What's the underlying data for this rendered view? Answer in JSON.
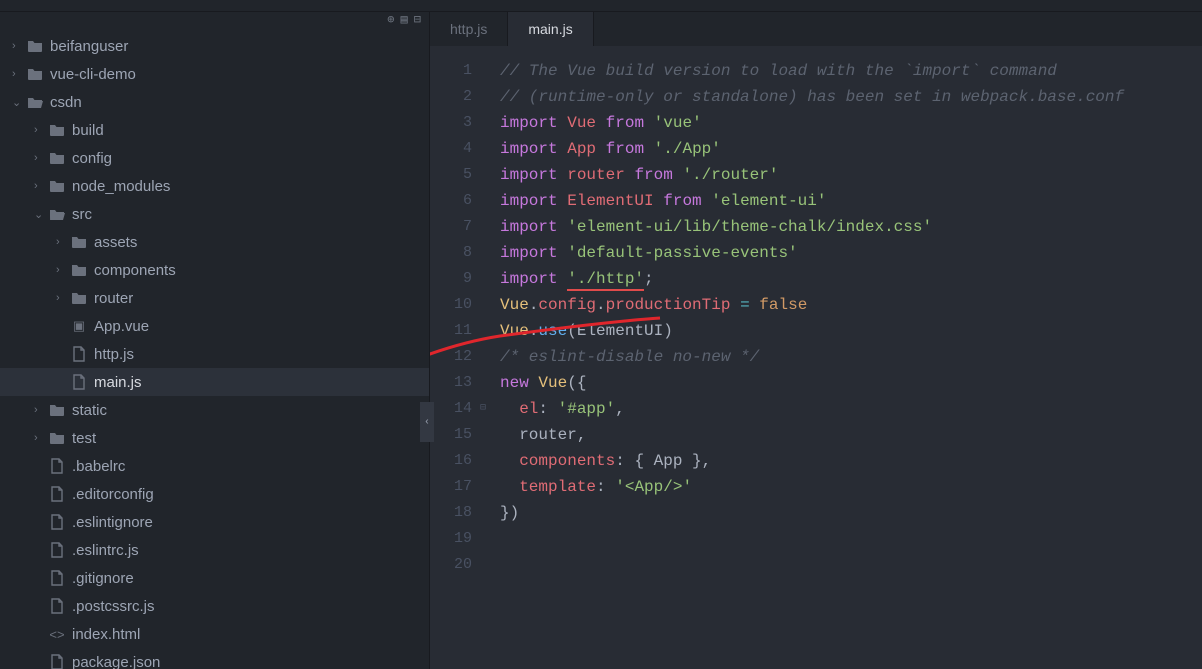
{
  "toolbar_icons": {
    "add": "⊕",
    "list": "▤",
    "collapse": "⊟"
  },
  "tree": [
    {
      "depth": 0,
      "chevron": "›",
      "icon": "folder",
      "label": "beifanguser"
    },
    {
      "depth": 0,
      "chevron": "›",
      "icon": "folder",
      "label": "vue-cli-demo"
    },
    {
      "depth": 0,
      "chevron": "⌄",
      "icon": "folder-open",
      "label": "csdn"
    },
    {
      "depth": 1,
      "chevron": "›",
      "icon": "folder",
      "label": "build"
    },
    {
      "depth": 1,
      "chevron": "›",
      "icon": "folder",
      "label": "config"
    },
    {
      "depth": 1,
      "chevron": "›",
      "icon": "folder",
      "label": "node_modules"
    },
    {
      "depth": 1,
      "chevron": "⌄",
      "icon": "folder-open",
      "label": "src"
    },
    {
      "depth": 2,
      "chevron": "›",
      "icon": "folder",
      "label": "assets"
    },
    {
      "depth": 2,
      "chevron": "›",
      "icon": "folder",
      "label": "components"
    },
    {
      "depth": 2,
      "chevron": "›",
      "icon": "folder",
      "label": "router"
    },
    {
      "depth": 2,
      "chevron": "",
      "icon": "vue",
      "label": "App.vue"
    },
    {
      "depth": 2,
      "chevron": "",
      "icon": "file",
      "label": "http.js"
    },
    {
      "depth": 2,
      "chevron": "",
      "icon": "file",
      "label": "main.js",
      "selected": true
    },
    {
      "depth": 1,
      "chevron": "›",
      "icon": "folder",
      "label": "static"
    },
    {
      "depth": 1,
      "chevron": "›",
      "icon": "folder",
      "label": "test"
    },
    {
      "depth": 1,
      "chevron": "",
      "icon": "file",
      "label": ".babelrc"
    },
    {
      "depth": 1,
      "chevron": "",
      "icon": "file",
      "label": ".editorconfig"
    },
    {
      "depth": 1,
      "chevron": "",
      "icon": "file",
      "label": ".eslintignore"
    },
    {
      "depth": 1,
      "chevron": "",
      "icon": "file",
      "label": ".eslintrc.js"
    },
    {
      "depth": 1,
      "chevron": "",
      "icon": "file",
      "label": ".gitignore"
    },
    {
      "depth": 1,
      "chevron": "",
      "icon": "file",
      "label": ".postcssrc.js"
    },
    {
      "depth": 1,
      "chevron": "",
      "icon": "html",
      "label": "index.html"
    },
    {
      "depth": 1,
      "chevron": "",
      "icon": "file",
      "label": "package.json"
    }
  ],
  "tabs": [
    {
      "label": "http.js",
      "active": false
    },
    {
      "label": "main.js",
      "active": true
    }
  ],
  "code_lines": [
    {
      "n": 1,
      "tokens": [
        [
          "c-comment",
          "// The Vue build version to load with the `import` command"
        ]
      ]
    },
    {
      "n": 2,
      "tokens": [
        [
          "c-comment",
          "// (runtime-only or standalone) has been set in webpack.base.conf"
        ]
      ]
    },
    {
      "n": 3,
      "tokens": [
        [
          "c-keyword",
          "import"
        ],
        [
          "",
          " "
        ],
        [
          "c-module",
          "Vue"
        ],
        [
          "",
          " "
        ],
        [
          "c-keyword",
          "from"
        ],
        [
          "",
          " "
        ],
        [
          "c-string",
          "'vue'"
        ]
      ]
    },
    {
      "n": 4,
      "tokens": [
        [
          "c-keyword",
          "import"
        ],
        [
          "",
          " "
        ],
        [
          "c-module",
          "App"
        ],
        [
          "",
          " "
        ],
        [
          "c-keyword",
          "from"
        ],
        [
          "",
          " "
        ],
        [
          "c-string",
          "'./App'"
        ]
      ]
    },
    {
      "n": 5,
      "tokens": [
        [
          "c-keyword",
          "import"
        ],
        [
          "",
          " "
        ],
        [
          "c-module",
          "router"
        ],
        [
          "",
          " "
        ],
        [
          "c-keyword",
          "from"
        ],
        [
          "",
          " "
        ],
        [
          "c-string",
          "'./router'"
        ]
      ]
    },
    {
      "n": 6,
      "tokens": [
        [
          "c-keyword",
          "import"
        ],
        [
          "",
          " "
        ],
        [
          "c-module",
          "ElementUI"
        ],
        [
          "",
          " "
        ],
        [
          "c-keyword",
          "from"
        ],
        [
          "",
          " "
        ],
        [
          "c-string",
          "'element-ui'"
        ]
      ]
    },
    {
      "n": 7,
      "tokens": [
        [
          "c-keyword",
          "import"
        ],
        [
          "",
          " "
        ],
        [
          "c-string",
          "'element-ui/lib/theme-chalk/index.css'"
        ]
      ]
    },
    {
      "n": 8,
      "tokens": [
        [
          "c-keyword",
          "import"
        ],
        [
          "",
          " "
        ],
        [
          "c-string",
          "'default-passive-events'"
        ]
      ]
    },
    {
      "n": 9,
      "tokens": [
        [
          "c-keyword",
          "import"
        ],
        [
          "",
          " "
        ],
        [
          "c-string underline-red",
          "'./http'"
        ],
        [
          "c-punct",
          ";"
        ]
      ]
    },
    {
      "n": 10,
      "tokens": [
        [
          "c-module2",
          "Vue"
        ],
        [
          "c-punct",
          "."
        ],
        [
          "c-prop",
          "config"
        ],
        [
          "c-punct",
          "."
        ],
        [
          "c-prop",
          "productionTip"
        ],
        [
          "",
          " "
        ],
        [
          "c-op",
          "="
        ],
        [
          "",
          " "
        ],
        [
          "c-const",
          "false"
        ]
      ]
    },
    {
      "n": 11,
      "tokens": [
        [
          "c-module2",
          "Vue"
        ],
        [
          "c-punct",
          "."
        ],
        [
          "c-func",
          "use"
        ],
        [
          "c-punct",
          "("
        ],
        [
          "c-punct",
          "ElementUI"
        ],
        [
          "c-punct",
          ")"
        ]
      ]
    },
    {
      "n": 12,
      "tokens": [
        [
          "c-comment",
          "/* eslint-disable no-new */"
        ]
      ]
    },
    {
      "n": 13,
      "tokens": [
        [
          "",
          ""
        ]
      ]
    },
    {
      "n": 14,
      "fold": true,
      "tokens": [
        [
          "c-keyword",
          "new"
        ],
        [
          "",
          " "
        ],
        [
          "c-module2",
          "Vue"
        ],
        [
          "c-punct",
          "("
        ],
        [
          "c-punct",
          "{"
        ]
      ]
    },
    {
      "n": 15,
      "tokens": [
        [
          "",
          "  "
        ],
        [
          "c-prop",
          "el"
        ],
        [
          "c-punct",
          ":"
        ],
        [
          "",
          " "
        ],
        [
          "c-string",
          "'#app'"
        ],
        [
          "c-punct",
          ","
        ]
      ]
    },
    {
      "n": 16,
      "tokens": [
        [
          "",
          "  "
        ],
        [
          "c-punct",
          "router,"
        ]
      ]
    },
    {
      "n": 17,
      "tokens": [
        [
          "",
          "  "
        ],
        [
          "c-prop",
          "components"
        ],
        [
          "c-punct",
          ":"
        ],
        [
          "",
          " "
        ],
        [
          "c-punct",
          "{ App },"
        ]
      ]
    },
    {
      "n": 18,
      "tokens": [
        [
          "",
          "  "
        ],
        [
          "c-prop",
          "template"
        ],
        [
          "c-punct",
          ":"
        ],
        [
          "",
          " "
        ],
        [
          "c-string",
          "'<App/>'"
        ]
      ]
    },
    {
      "n": 19,
      "tokens": [
        [
          "c-punct",
          "})"
        ]
      ]
    },
    {
      "n": 20,
      "tokens": [
        [
          "",
          ""
        ]
      ]
    }
  ],
  "collapse_glyph": "‹"
}
